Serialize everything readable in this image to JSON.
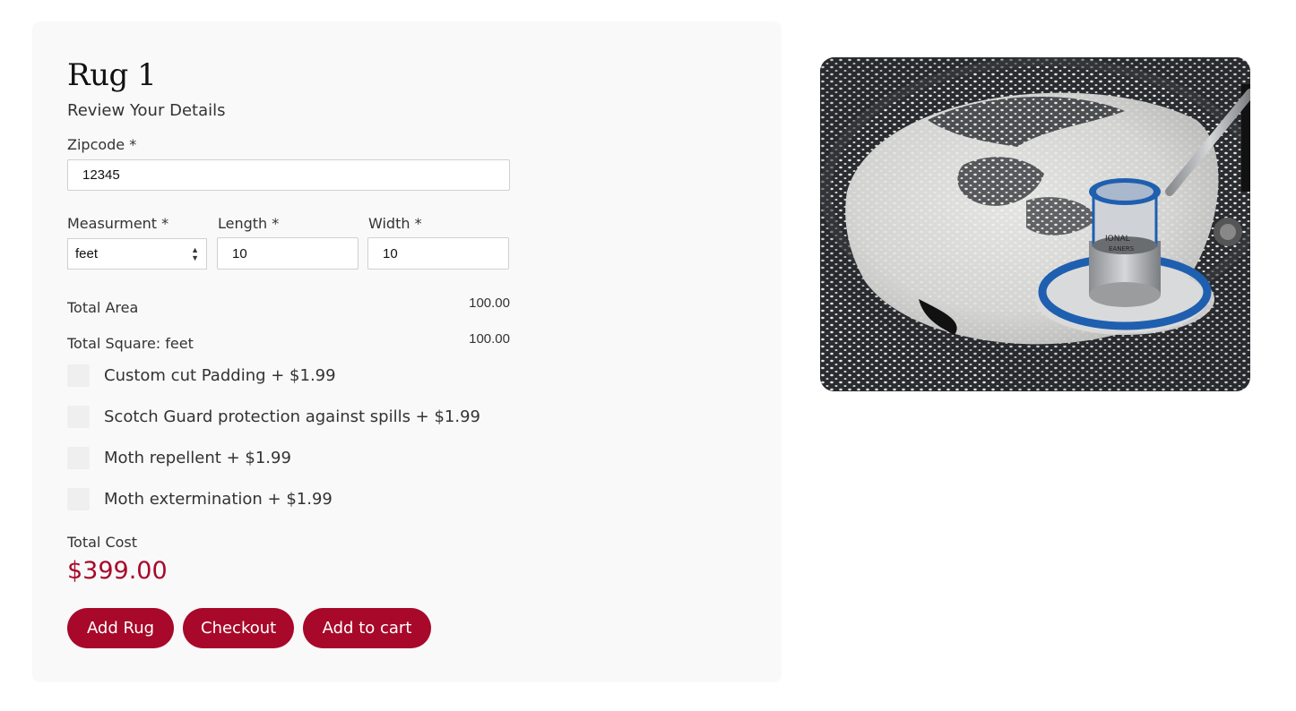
{
  "form": {
    "title": "Rug 1",
    "subtitle": "Review Your Details",
    "zipcode": {
      "label": "Zipcode *",
      "value": "12345"
    },
    "measurement": {
      "label": "Measurment *",
      "selected": "feet"
    },
    "length": {
      "label": "Length *",
      "value": "10"
    },
    "width": {
      "label": "Width *",
      "value": "10"
    },
    "summary": [
      {
        "label": "Total Area",
        "value": "100.00"
      },
      {
        "label": "Total Square: feet",
        "value": "100.00"
      }
    ],
    "options": [
      {
        "label": "Custom cut Padding + $1.99",
        "checked": false
      },
      {
        "label": "Scotch Guard protection against spills + $1.99",
        "checked": false
      },
      {
        "label": "Moth repellent + $1.99",
        "checked": false
      },
      {
        "label": "Moth extermination + $1.99",
        "checked": false
      }
    ],
    "total_cost": {
      "label": "Total Cost",
      "value": "$399.00"
    },
    "buttons": {
      "add_rug": "Add Rug",
      "checkout": "Checkout",
      "add_to_cart": "Add to cart"
    }
  },
  "photo": {
    "machine_label_line1": "IONAL",
    "machine_label_line2": "EANERS"
  },
  "colors": {
    "accent": "#a8082a",
    "card_bg": "#f9f9f9"
  }
}
